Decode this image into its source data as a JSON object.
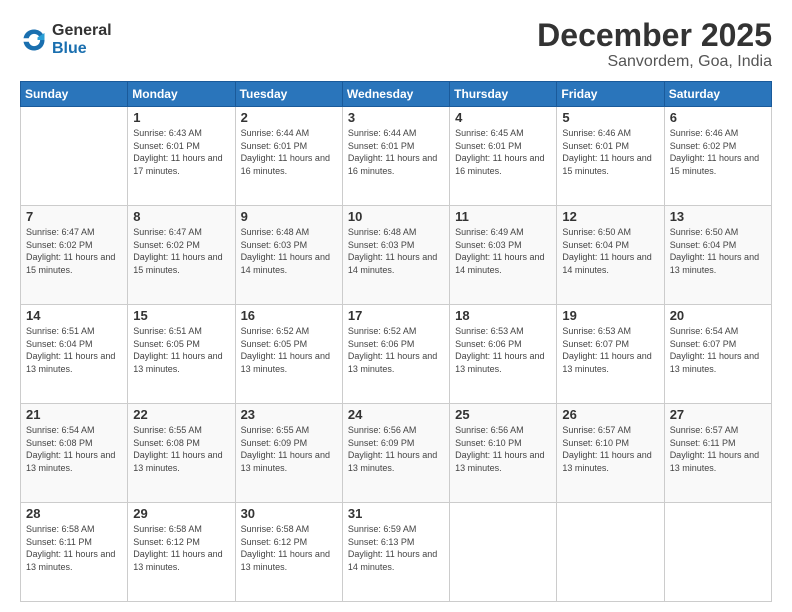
{
  "logo": {
    "general": "General",
    "blue": "Blue"
  },
  "header": {
    "month": "December 2025",
    "location": "Sanvordem, Goa, India"
  },
  "weekdays": [
    "Sunday",
    "Monday",
    "Tuesday",
    "Wednesday",
    "Thursday",
    "Friday",
    "Saturday"
  ],
  "weeks": [
    [
      {
        "day": "",
        "sunrise": "",
        "sunset": "",
        "daylight": ""
      },
      {
        "day": "1",
        "sunrise": "Sunrise: 6:43 AM",
        "sunset": "Sunset: 6:01 PM",
        "daylight": "Daylight: 11 hours and 17 minutes."
      },
      {
        "day": "2",
        "sunrise": "Sunrise: 6:44 AM",
        "sunset": "Sunset: 6:01 PM",
        "daylight": "Daylight: 11 hours and 16 minutes."
      },
      {
        "day": "3",
        "sunrise": "Sunrise: 6:44 AM",
        "sunset": "Sunset: 6:01 PM",
        "daylight": "Daylight: 11 hours and 16 minutes."
      },
      {
        "day": "4",
        "sunrise": "Sunrise: 6:45 AM",
        "sunset": "Sunset: 6:01 PM",
        "daylight": "Daylight: 11 hours and 16 minutes."
      },
      {
        "day": "5",
        "sunrise": "Sunrise: 6:46 AM",
        "sunset": "Sunset: 6:01 PM",
        "daylight": "Daylight: 11 hours and 15 minutes."
      },
      {
        "day": "6",
        "sunrise": "Sunrise: 6:46 AM",
        "sunset": "Sunset: 6:02 PM",
        "daylight": "Daylight: 11 hours and 15 minutes."
      }
    ],
    [
      {
        "day": "7",
        "sunrise": "Sunrise: 6:47 AM",
        "sunset": "Sunset: 6:02 PM",
        "daylight": "Daylight: 11 hours and 15 minutes."
      },
      {
        "day": "8",
        "sunrise": "Sunrise: 6:47 AM",
        "sunset": "Sunset: 6:02 PM",
        "daylight": "Daylight: 11 hours and 15 minutes."
      },
      {
        "day": "9",
        "sunrise": "Sunrise: 6:48 AM",
        "sunset": "Sunset: 6:03 PM",
        "daylight": "Daylight: 11 hours and 14 minutes."
      },
      {
        "day": "10",
        "sunrise": "Sunrise: 6:48 AM",
        "sunset": "Sunset: 6:03 PM",
        "daylight": "Daylight: 11 hours and 14 minutes."
      },
      {
        "day": "11",
        "sunrise": "Sunrise: 6:49 AM",
        "sunset": "Sunset: 6:03 PM",
        "daylight": "Daylight: 11 hours and 14 minutes."
      },
      {
        "day": "12",
        "sunrise": "Sunrise: 6:50 AM",
        "sunset": "Sunset: 6:04 PM",
        "daylight": "Daylight: 11 hours and 14 minutes."
      },
      {
        "day": "13",
        "sunrise": "Sunrise: 6:50 AM",
        "sunset": "Sunset: 6:04 PM",
        "daylight": "Daylight: 11 hours and 13 minutes."
      }
    ],
    [
      {
        "day": "14",
        "sunrise": "Sunrise: 6:51 AM",
        "sunset": "Sunset: 6:04 PM",
        "daylight": "Daylight: 11 hours and 13 minutes."
      },
      {
        "day": "15",
        "sunrise": "Sunrise: 6:51 AM",
        "sunset": "Sunset: 6:05 PM",
        "daylight": "Daylight: 11 hours and 13 minutes."
      },
      {
        "day": "16",
        "sunrise": "Sunrise: 6:52 AM",
        "sunset": "Sunset: 6:05 PM",
        "daylight": "Daylight: 11 hours and 13 minutes."
      },
      {
        "day": "17",
        "sunrise": "Sunrise: 6:52 AM",
        "sunset": "Sunset: 6:06 PM",
        "daylight": "Daylight: 11 hours and 13 minutes."
      },
      {
        "day": "18",
        "sunrise": "Sunrise: 6:53 AM",
        "sunset": "Sunset: 6:06 PM",
        "daylight": "Daylight: 11 hours and 13 minutes."
      },
      {
        "day": "19",
        "sunrise": "Sunrise: 6:53 AM",
        "sunset": "Sunset: 6:07 PM",
        "daylight": "Daylight: 11 hours and 13 minutes."
      },
      {
        "day": "20",
        "sunrise": "Sunrise: 6:54 AM",
        "sunset": "Sunset: 6:07 PM",
        "daylight": "Daylight: 11 hours and 13 minutes."
      }
    ],
    [
      {
        "day": "21",
        "sunrise": "Sunrise: 6:54 AM",
        "sunset": "Sunset: 6:08 PM",
        "daylight": "Daylight: 11 hours and 13 minutes."
      },
      {
        "day": "22",
        "sunrise": "Sunrise: 6:55 AM",
        "sunset": "Sunset: 6:08 PM",
        "daylight": "Daylight: 11 hours and 13 minutes."
      },
      {
        "day": "23",
        "sunrise": "Sunrise: 6:55 AM",
        "sunset": "Sunset: 6:09 PM",
        "daylight": "Daylight: 11 hours and 13 minutes."
      },
      {
        "day": "24",
        "sunrise": "Sunrise: 6:56 AM",
        "sunset": "Sunset: 6:09 PM",
        "daylight": "Daylight: 11 hours and 13 minutes."
      },
      {
        "day": "25",
        "sunrise": "Sunrise: 6:56 AM",
        "sunset": "Sunset: 6:10 PM",
        "daylight": "Daylight: 11 hours and 13 minutes."
      },
      {
        "day": "26",
        "sunrise": "Sunrise: 6:57 AM",
        "sunset": "Sunset: 6:10 PM",
        "daylight": "Daylight: 11 hours and 13 minutes."
      },
      {
        "day": "27",
        "sunrise": "Sunrise: 6:57 AM",
        "sunset": "Sunset: 6:11 PM",
        "daylight": "Daylight: 11 hours and 13 minutes."
      }
    ],
    [
      {
        "day": "28",
        "sunrise": "Sunrise: 6:58 AM",
        "sunset": "Sunset: 6:11 PM",
        "daylight": "Daylight: 11 hours and 13 minutes."
      },
      {
        "day": "29",
        "sunrise": "Sunrise: 6:58 AM",
        "sunset": "Sunset: 6:12 PM",
        "daylight": "Daylight: 11 hours and 13 minutes."
      },
      {
        "day": "30",
        "sunrise": "Sunrise: 6:58 AM",
        "sunset": "Sunset: 6:12 PM",
        "daylight": "Daylight: 11 hours and 13 minutes."
      },
      {
        "day": "31",
        "sunrise": "Sunrise: 6:59 AM",
        "sunset": "Sunset: 6:13 PM",
        "daylight": "Daylight: 11 hours and 14 minutes."
      },
      {
        "day": "",
        "sunrise": "",
        "sunset": "",
        "daylight": ""
      },
      {
        "day": "",
        "sunrise": "",
        "sunset": "",
        "daylight": ""
      },
      {
        "day": "",
        "sunrise": "",
        "sunset": "",
        "daylight": ""
      }
    ]
  ]
}
